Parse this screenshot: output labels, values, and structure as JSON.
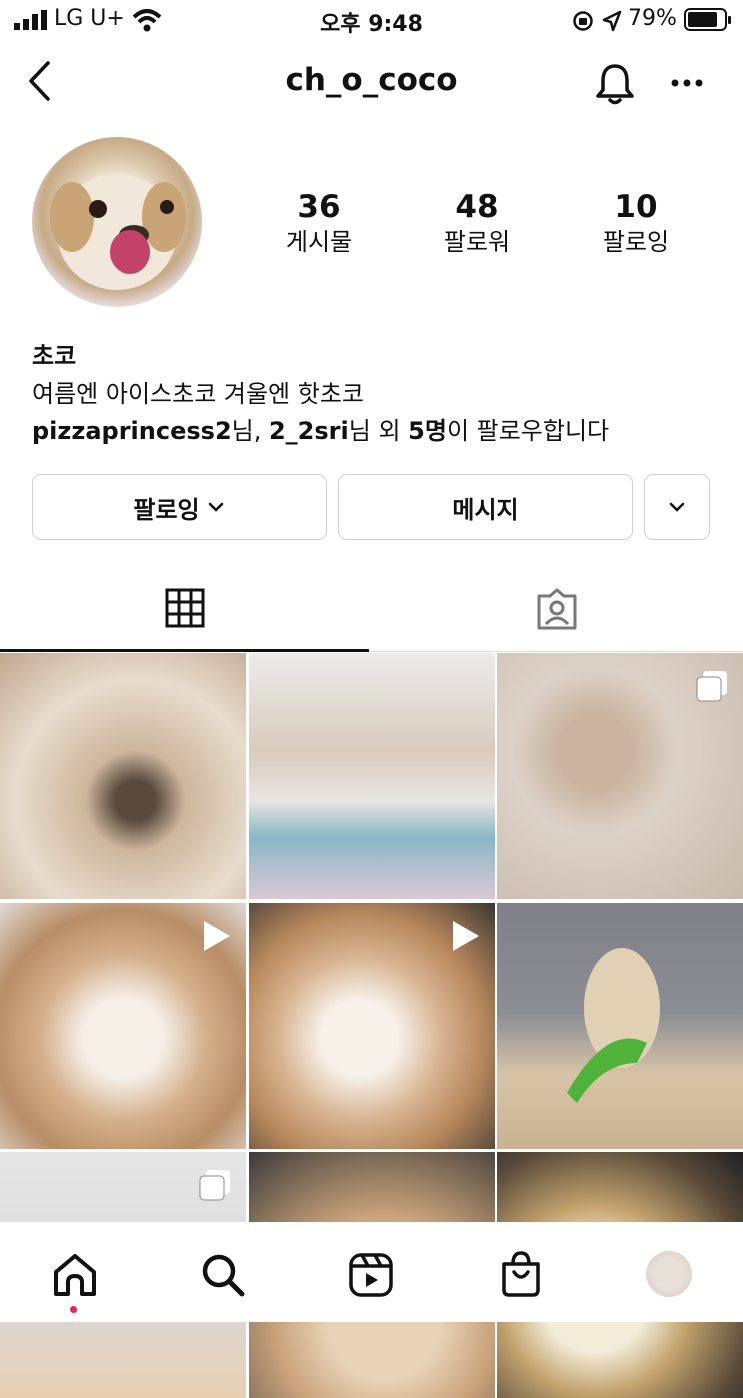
{
  "status_bar": {
    "carrier": "LG U+",
    "time": "오후 9:48",
    "battery": "79%"
  },
  "header": {
    "username": "ch_o_coco",
    "icons": [
      "back-icon",
      "bell-icon",
      "more-icon"
    ]
  },
  "profile": {
    "stats": [
      {
        "value": "36",
        "label": "게시물"
      },
      {
        "value": "48",
        "label": "팔로워"
      },
      {
        "value": "10",
        "label": "팔로잉"
      }
    ],
    "name": "초코",
    "bio": "여름엔 아이스초코 겨울엔 핫초코",
    "followed_by": {
      "user1": "pizzaprincess2",
      "suffix1": "님, ",
      "user2": "2_2sri",
      "suffix2": "님 외 ",
      "count": "5명",
      "suffix3": "이 팔로우합니다"
    }
  },
  "actions": {
    "following_label": "팔로잉",
    "message_label": "메시지"
  },
  "tabs": [
    "grid-icon",
    "tagged-icon"
  ],
  "colors": {
    "accent_dot": "#e0245e",
    "border": "#cfcfcf",
    "text": "#111111"
  },
  "grid": [
    {
      "kind": "photo",
      "badge": "none"
    },
    {
      "kind": "photo",
      "badge": "none"
    },
    {
      "kind": "photo",
      "badge": "carousel"
    },
    {
      "kind": "photo",
      "badge": "video"
    },
    {
      "kind": "photo",
      "badge": "video"
    },
    {
      "kind": "photo",
      "badge": "none"
    },
    {
      "kind": "photo",
      "badge": "carousel"
    },
    {
      "kind": "photo",
      "badge": "none"
    },
    {
      "kind": "photo",
      "badge": "none"
    }
  ],
  "bottom_nav": [
    "home-icon",
    "search-icon",
    "reels-icon",
    "shop-icon",
    "profile-avatar"
  ]
}
